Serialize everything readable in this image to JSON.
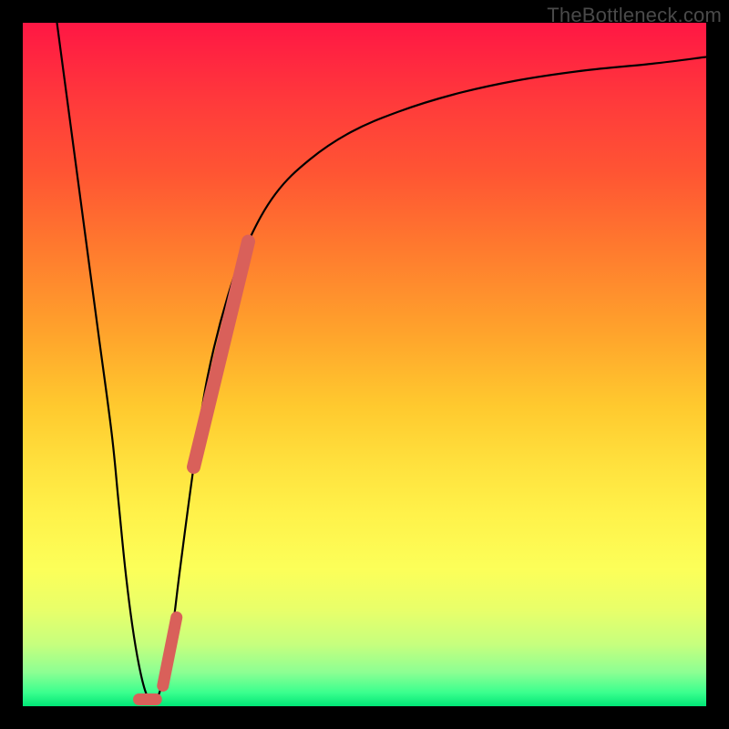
{
  "watermark": "TheBottleneck.com",
  "chart_data": {
    "type": "line",
    "title": "",
    "xlabel": "",
    "ylabel": "",
    "xlim": [
      0,
      100
    ],
    "ylim": [
      0,
      100
    ],
    "series": [
      {
        "name": "bottleneck-curve",
        "x": [
          5,
          7,
          9,
          11,
          13,
          14,
          15,
          16,
          17,
          18,
          19,
          20,
          21,
          22,
          23,
          25,
          27,
          30,
          33,
          37,
          42,
          48,
          55,
          63,
          72,
          82,
          92,
          100
        ],
        "y": [
          100,
          85,
          70,
          55,
          40,
          30,
          20,
          12,
          6,
          2,
          0.5,
          2,
          6,
          12,
          20,
          35,
          48,
          60,
          68,
          75,
          80,
          84,
          87,
          89.5,
          91.5,
          93,
          94,
          95
        ]
      },
      {
        "name": "highlight-long",
        "x": [
          25,
          33
        ],
        "y": [
          35,
          68
        ]
      },
      {
        "name": "highlight-short",
        "x": [
          20.5,
          22.5
        ],
        "y": [
          3,
          13
        ]
      },
      {
        "name": "highlight-dot",
        "x": [
          17,
          19.5
        ],
        "y": [
          1,
          1
        ]
      }
    ],
    "colors": {
      "curve": "#000000",
      "highlight": "#d9605a"
    }
  }
}
